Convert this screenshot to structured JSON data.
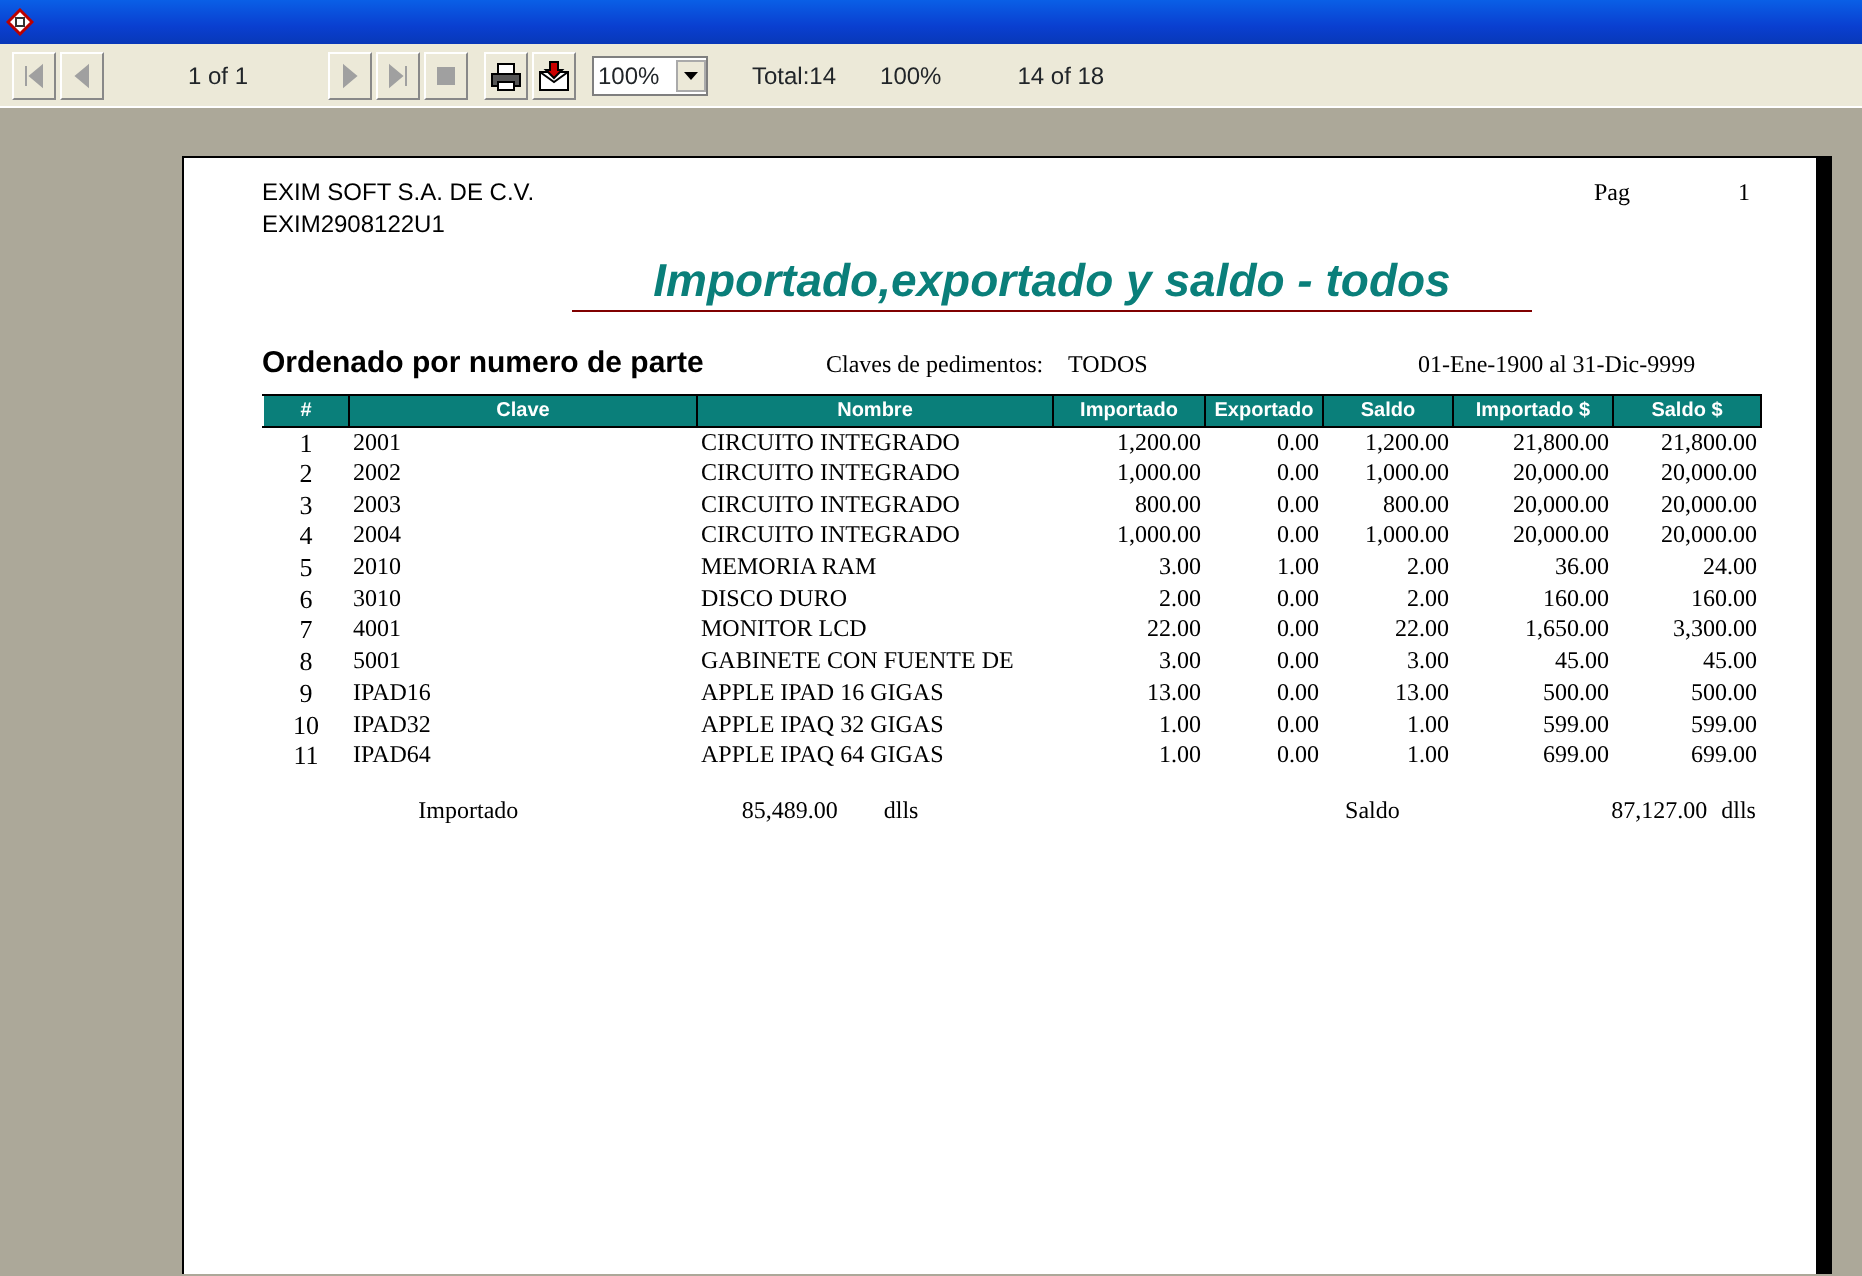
{
  "toolbar": {
    "nav_buttons": [
      {
        "kind": "first",
        "disabled": true
      },
      {
        "kind": "prev",
        "disabled": true
      }
    ],
    "page_label": "1 of 1",
    "nav_buttons_2": [
      {
        "kind": "next",
        "disabled": true
      },
      {
        "kind": "last",
        "disabled": true
      },
      {
        "kind": "stop",
        "disabled": true
      }
    ],
    "tool_buttons": [
      {
        "kind": "print"
      },
      {
        "kind": "export"
      }
    ],
    "zoom": {
      "value": "100%"
    },
    "status": [
      "Total:14",
      "100%",
      "14 of 18"
    ]
  },
  "report": {
    "company": "EXIM SOFT S.A. DE C.V.",
    "rfc": "EXIM2908122U1",
    "page_label": "Pag",
    "page_number": "1",
    "title": "Importado,exportado y saldo - todos",
    "subtitle": "Ordenado por numero de parte",
    "filter_label": "Claves de pedimentos:",
    "filter_value": "TODOS",
    "date_range": "01-Ene-1900 al 31-Dic-9999",
    "columns": [
      "#",
      "Clave",
      "Nombre",
      "Importado",
      "Exportado",
      "Saldo",
      "Importado $",
      "Saldo $"
    ],
    "rows": [
      [
        "1",
        "2001",
        "CIRCUITO INTEGRADO",
        "1,200.00",
        "0.00",
        "1,200.00",
        "21,800.00",
        "21,800.00"
      ],
      [
        "2",
        "2002",
        "CIRCUITO INTEGRADO",
        "1,000.00",
        "0.00",
        "1,000.00",
        "20,000.00",
        "20,000.00"
      ],
      [
        "3",
        "2003",
        "CIRCUITO INTEGRADO",
        "800.00",
        "0.00",
        "800.00",
        "20,000.00",
        "20,000.00"
      ],
      [
        "4",
        "2004",
        "CIRCUITO INTEGRADO",
        "1,000.00",
        "0.00",
        "1,000.00",
        "20,000.00",
        "20,000.00"
      ],
      [
        "5",
        "2010",
        "MEMORIA RAM",
        "3.00",
        "1.00",
        "2.00",
        "36.00",
        "24.00"
      ],
      [
        "6",
        "3010",
        "DISCO DURO",
        "2.00",
        "0.00",
        "2.00",
        "160.00",
        "160.00"
      ],
      [
        "7",
        "4001",
        "MONITOR LCD",
        "22.00",
        "0.00",
        "22.00",
        "1,650.00",
        "3,300.00"
      ],
      [
        "8",
        "5001",
        "GABINETE CON FUENTE DE",
        "3.00",
        "0.00",
        "3.00",
        "45.00",
        "45.00"
      ],
      [
        "9",
        "IPAD16",
        "APPLE IPAD 16 GIGAS",
        "13.00",
        "0.00",
        "13.00",
        "500.00",
        "500.00"
      ],
      [
        "10",
        "IPAD32",
        "APPLE IPAQ 32 GIGAS",
        "1.00",
        "0.00",
        "1.00",
        "599.00",
        "599.00"
      ],
      [
        "11",
        "IPAD64",
        "APPLE IPAQ 64 GIGAS",
        "1.00",
        "0.00",
        "1.00",
        "699.00",
        "699.00"
      ]
    ],
    "totals": {
      "imported_label": "Importado",
      "imported_value": "85,489.00",
      "imported_unit": "dlls",
      "balance_label": "Saldo",
      "balance_value": "87,127.00",
      "balance_unit": "dlls"
    }
  }
}
